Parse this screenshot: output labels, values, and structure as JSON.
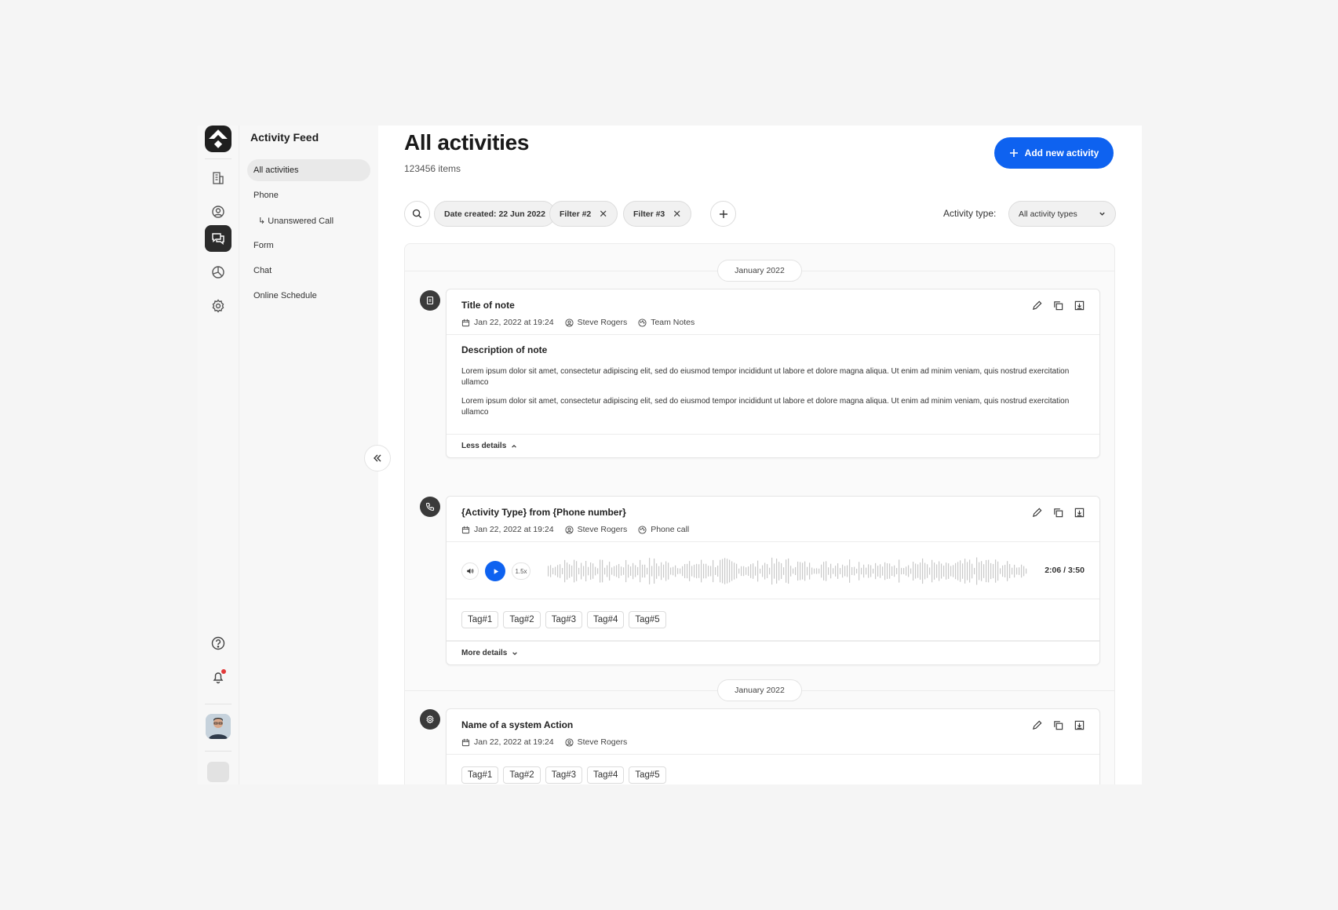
{
  "sidebar": {
    "title": "Activity Feed",
    "items": [
      {
        "label": "All activities"
      },
      {
        "label": "Phone"
      },
      {
        "label": "↳ Unanswered Call"
      },
      {
        "label": "Form"
      },
      {
        "label": "Chat"
      },
      {
        "label": "Online Schedule"
      }
    ],
    "rail_icons": [
      "building-icon",
      "user-circle-icon",
      "chat-icon",
      "pie-chart-icon",
      "gear-icon",
      "help-icon",
      "bell-icon"
    ]
  },
  "header": {
    "title": "All activities",
    "count": "123456 items",
    "add_button": "Add new activity"
  },
  "filters": {
    "chips": [
      "Date created: 22 Jun 2022",
      "Filter #2",
      "Filter #3"
    ],
    "type_label": "Activity type:",
    "type_value": "All activity types"
  },
  "feed": {
    "months": [
      "January 2022",
      "January 2022"
    ],
    "note": {
      "title": "Title of note",
      "date": "Jan 22, 2022 at 19:24",
      "user": "Steve Rogers",
      "category": "Team Notes",
      "desc_title": "Description of note",
      "paragraphs": [
        "Lorem ipsum dolor sit amet, consectetur adipiscing elit, sed do eiusmod tempor incididunt ut labore et dolore magna aliqua. Ut enim ad minim veniam, quis nostrud exercitation ullamco",
        "Lorem ipsum dolor sit amet, consectetur adipiscing elit, sed do eiusmod tempor incididunt ut labore et dolore magna aliqua. Ut enim ad minim veniam, quis nostrud exercitation ullamco"
      ],
      "toggle": "Less details"
    },
    "call": {
      "title": "{Activity Type} from {Phone number}",
      "date": "Jan 22, 2022 at 19:24",
      "user": "Steve Rogers",
      "category": "Phone call",
      "speed": "1.5x",
      "time": "2:06 / 3:50",
      "tags": [
        "Tag#1",
        "Tag#2",
        "Tag#3",
        "Tag#4",
        "Tag#5"
      ],
      "toggle": "More details"
    },
    "system": {
      "title": "Name of a system Action",
      "date": "Jan 22, 2022 at 19:24",
      "user": "Steve Rogers",
      "tags": [
        "Tag#1",
        "Tag#2",
        "Tag#3",
        "Tag#4",
        "Tag#5"
      ]
    }
  },
  "colors": {
    "accent": "#0e62f0",
    "notification": "#e23a3a"
  }
}
